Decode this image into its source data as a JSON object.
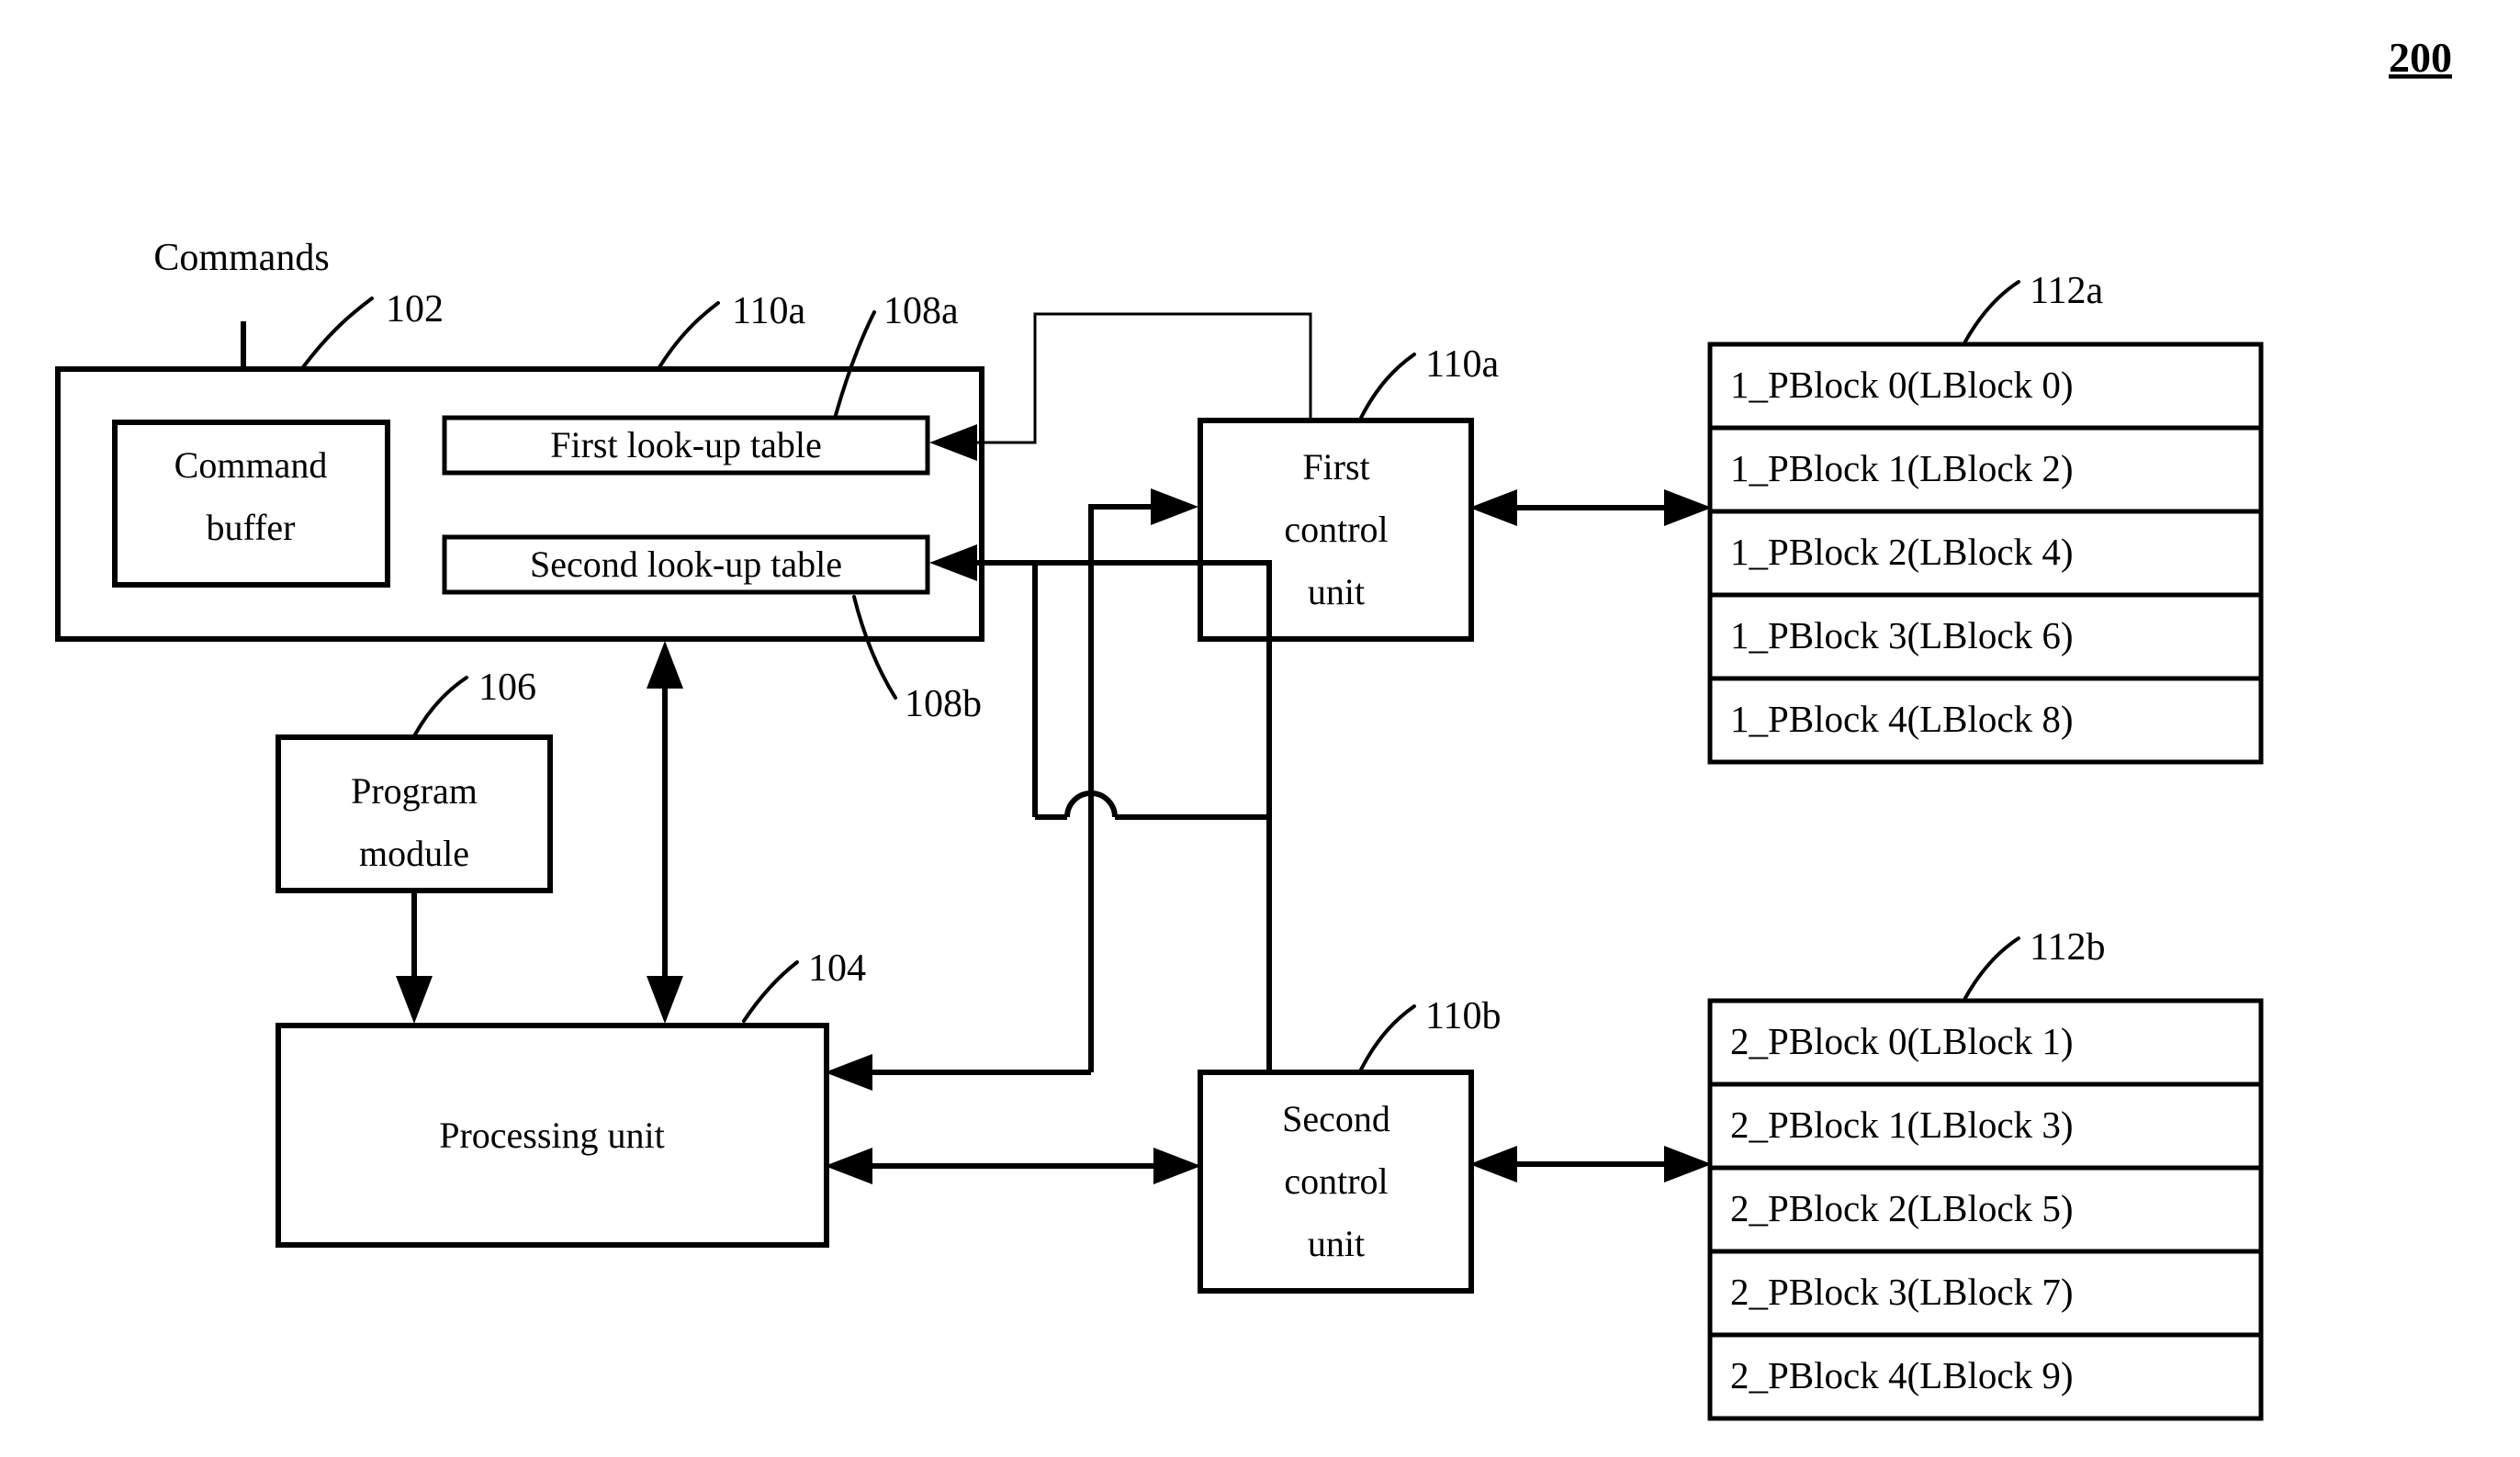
{
  "figure": {
    "number": "200"
  },
  "labels": {
    "commands": "Commands"
  },
  "blocks": {
    "memory_device": {
      "ref": "102"
    },
    "command_buffer": {
      "line1": "Command",
      "line2": "buffer"
    },
    "first_lookup_table": {
      "label": "First look-up table",
      "ref": "108a"
    },
    "second_lookup_table": {
      "label": "Second look-up table",
      "ref": "108b"
    },
    "lookup_group": {
      "ref": "110a"
    },
    "program_module": {
      "line1": "Program",
      "line2": "module",
      "ref": "106"
    },
    "processing_unit": {
      "label": "Processing unit",
      "ref": "104"
    },
    "first_control_unit": {
      "line1": "First",
      "line2": "control",
      "line3": "unit",
      "ref": "110a"
    },
    "second_control_unit": {
      "line1": "Second",
      "line2": "control",
      "line3": "unit",
      "ref": "110b"
    }
  },
  "pblock_table_a": {
    "ref": "112a",
    "rows": [
      "1_PBlock 0(LBlock 0)",
      "1_PBlock 1(LBlock 2)",
      "1_PBlock 2(LBlock 4)",
      "1_PBlock 3(LBlock 6)",
      "1_PBlock 4(LBlock 8)"
    ]
  },
  "pblock_table_b": {
    "ref": "112b",
    "rows": [
      "2_PBlock 0(LBlock 1)",
      "2_PBlock 1(LBlock 3)",
      "2_PBlock 2(LBlock 5)",
      "2_PBlock 3(LBlock 7)",
      "2_PBlock 4(LBlock 9)"
    ]
  },
  "colors": {
    "stroke": "#000000",
    "fill": "#ffffff"
  }
}
